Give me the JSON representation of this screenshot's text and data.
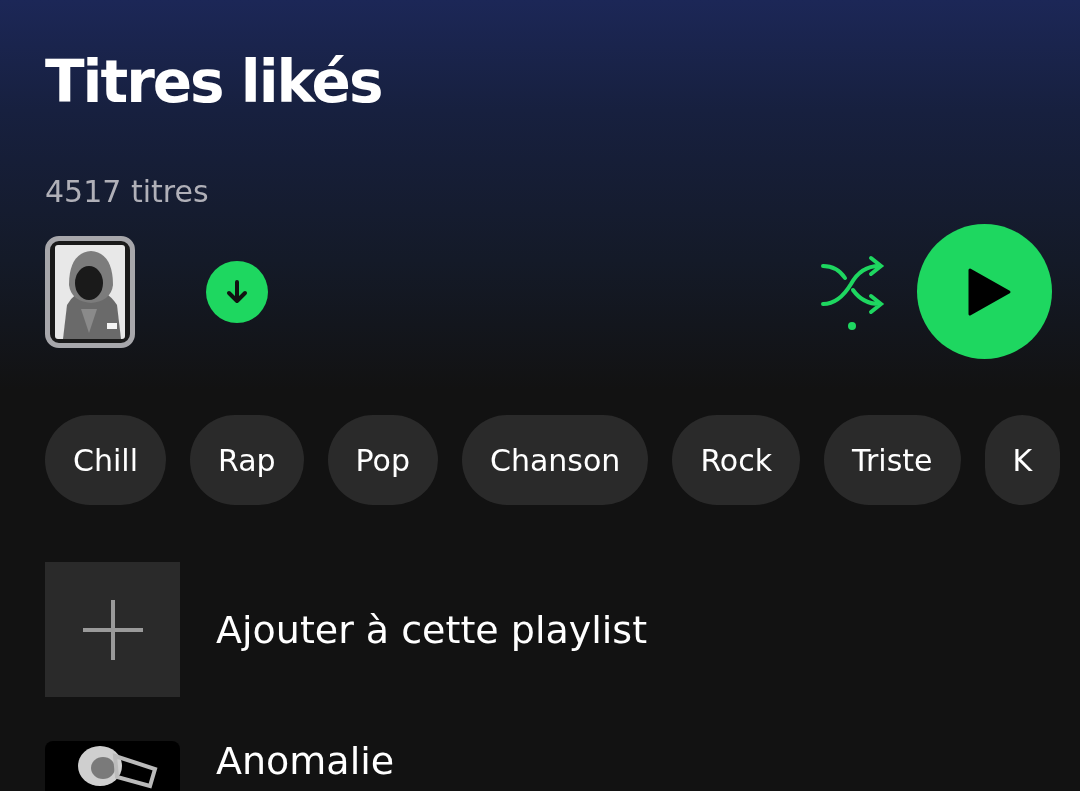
{
  "header": {
    "title": "Titres likés",
    "track_count": "4517 titres"
  },
  "controls": {
    "downloaded": true,
    "shuffle_on": true
  },
  "filters": [
    {
      "label": "Chill",
      "selected": false
    },
    {
      "label": "Rap",
      "selected": false
    },
    {
      "label": "Pop",
      "selected": false
    },
    {
      "label": "Chanson",
      "selected": false
    },
    {
      "label": "Rock",
      "selected": false
    },
    {
      "label": "Triste",
      "selected": false
    },
    {
      "label": "K",
      "selected": false
    }
  ],
  "add_row": {
    "label": "Ajouter à cette playlist"
  },
  "tracks": [
    {
      "title": "Anomalie",
      "kind": "picture"
    }
  ]
}
